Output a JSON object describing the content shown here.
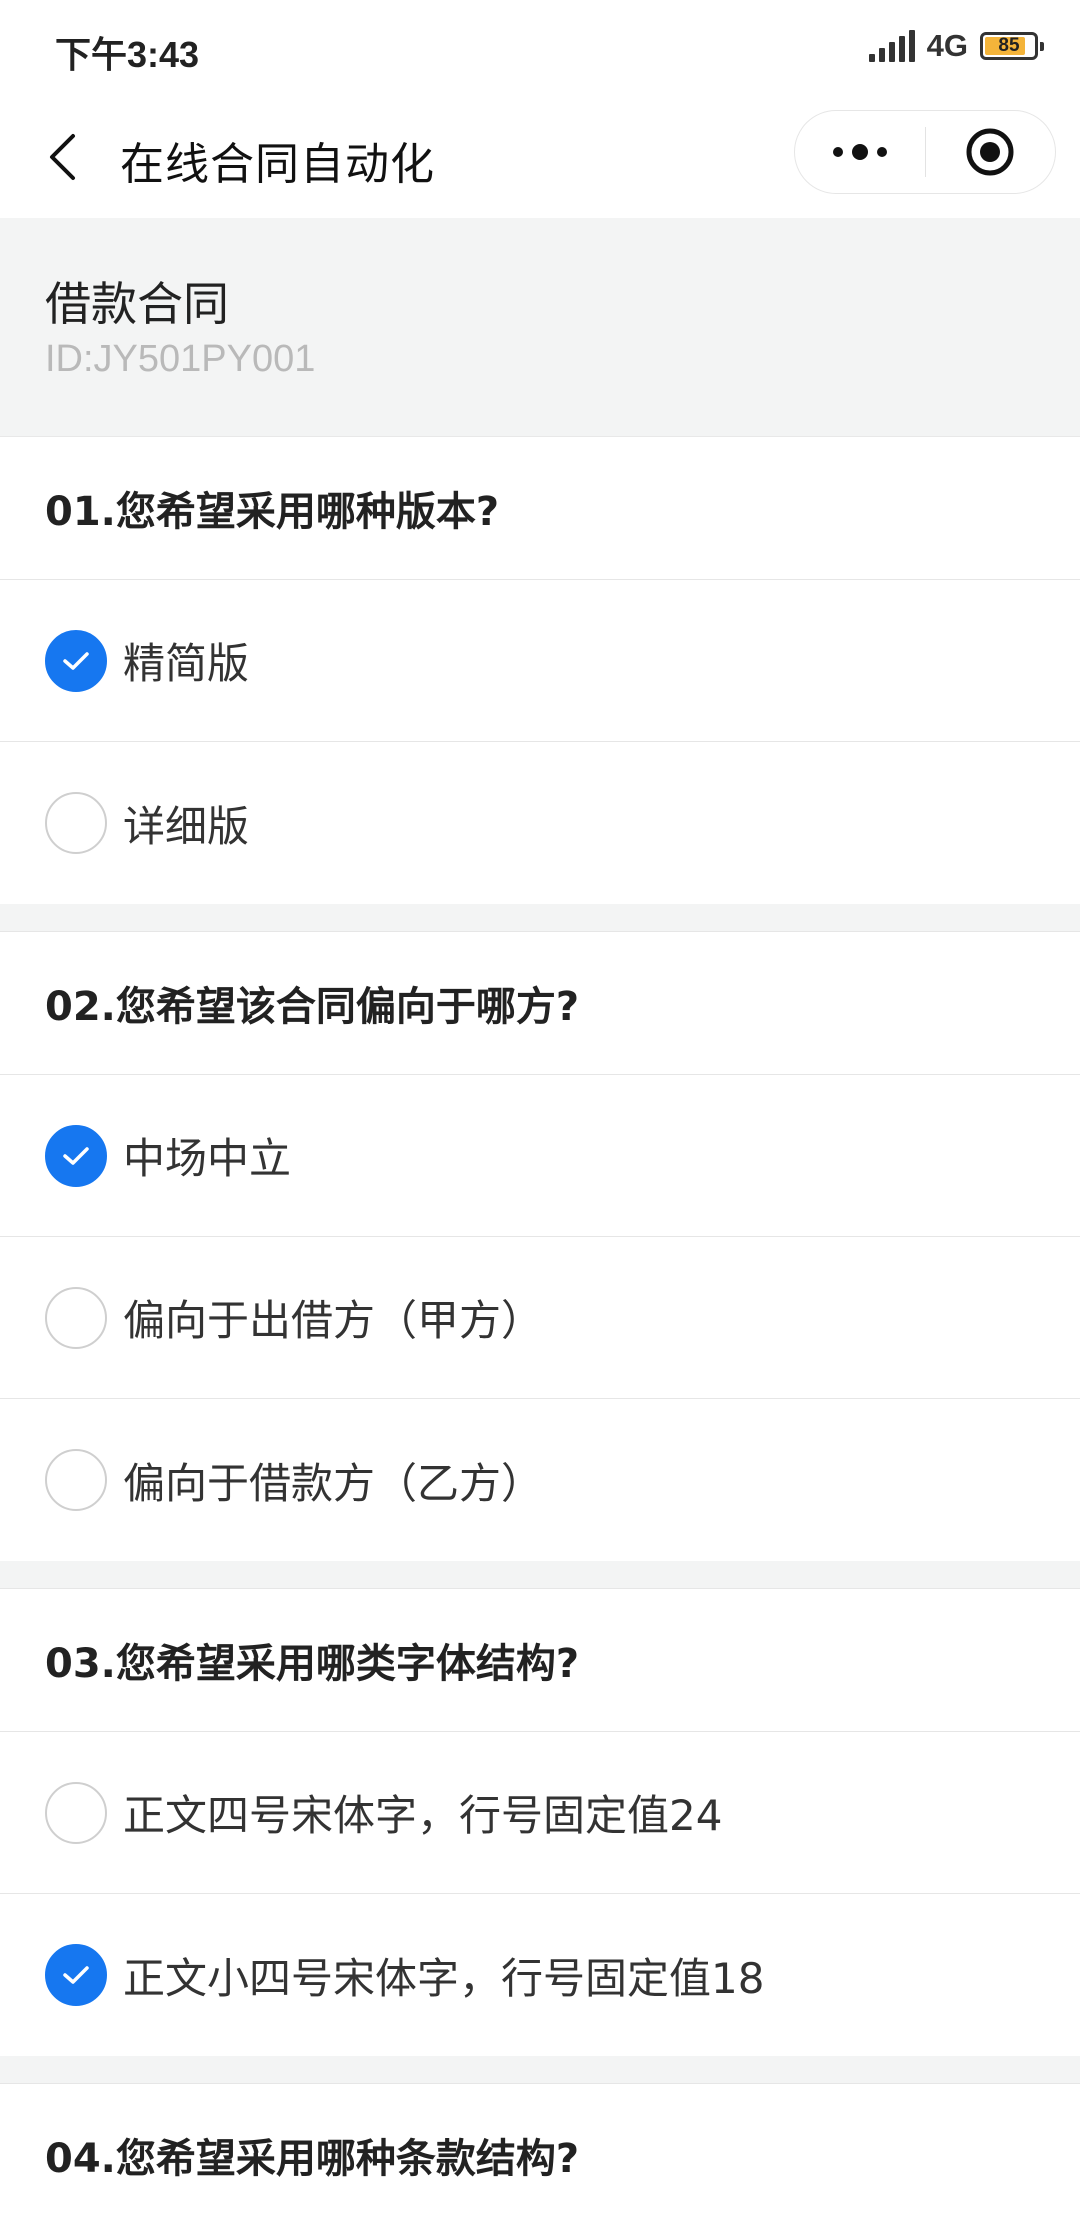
{
  "status": {
    "time": "下午3:43",
    "network": "4G",
    "battery": "85",
    "battery_level": 0.85
  },
  "nav": {
    "title": "在线合同自动化"
  },
  "contract": {
    "name": "借款合同",
    "id": "ID:JY501PY001"
  },
  "questions": [
    {
      "title": "01.您希望采用哪种版本?",
      "options": [
        {
          "label": "精简版",
          "checked": true
        },
        {
          "label": "详细版",
          "checked": false
        }
      ]
    },
    {
      "title": "02.您希望该合同偏向于哪方?",
      "options": [
        {
          "label": "中场中立",
          "checked": true
        },
        {
          "label": "偏向于出借方（甲方）",
          "checked": false
        },
        {
          "label": "偏向于借款方（乙方）",
          "checked": false
        }
      ]
    },
    {
      "title": "03.您希望采用哪类字体结构?",
      "options": [
        {
          "label": "正文四号宋体字，行号固定值24",
          "checked": false
        },
        {
          "label": "正文小四号宋体字，行号固定值18",
          "checked": true
        }
      ]
    },
    {
      "title": "04.您希望采用哪种条款结构?",
      "options": []
    }
  ],
  "colors": {
    "accent": "#1677f0",
    "section_bg": "#f3f4f4",
    "id_text": "#b9b9b9"
  }
}
